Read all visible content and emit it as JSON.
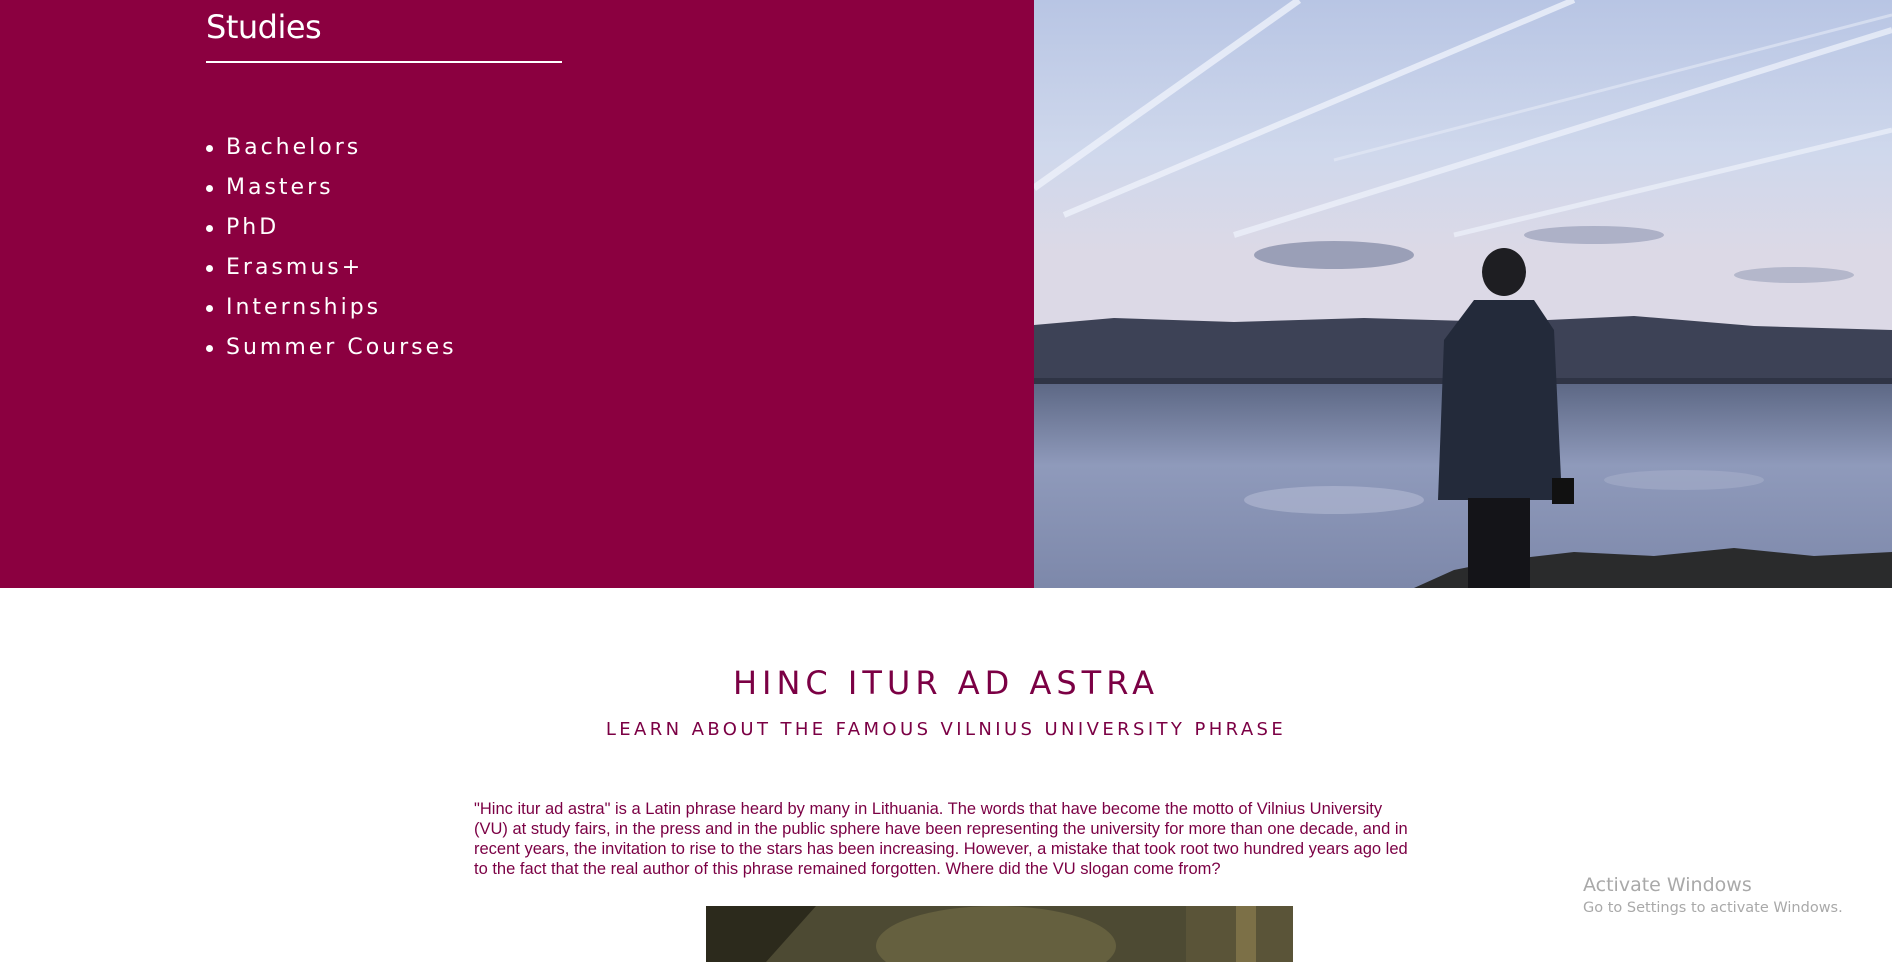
{
  "studies": {
    "title": "Studies",
    "items": [
      {
        "label": "Bachelors"
      },
      {
        "label": "Masters"
      },
      {
        "label": "PhD"
      },
      {
        "label": "Erasmus+"
      },
      {
        "label": "Internships"
      },
      {
        "label": "Summer Courses"
      }
    ]
  },
  "colors": {
    "panel": "#8b0040",
    "accent_text": "#7b0044",
    "background": "#ffffff"
  },
  "article": {
    "headline": "HINC ITUR AD ASTRA",
    "subheadline": "LEARN ABOUT THE FAMOUS VILNIUS UNIVERSITY PHRASE",
    "paragraph": "\"Hinc itur ad astra\" is a Latin phrase heard by many in Lithuania. The words that have become the motto of Vilnius University (VU) at study fairs, in the press and in the public sphere have been representing the university for more than one decade, and in recent years, the invitation to rise to the stars has been increasing. However, a mistake that took root two hundred years ago led to the fact that the real author of this phrase remained forgotten. Where did the VU slogan come from?"
  },
  "os_watermark": {
    "line1": "Activate Windows",
    "line2": "Go to Settings to activate Windows."
  }
}
